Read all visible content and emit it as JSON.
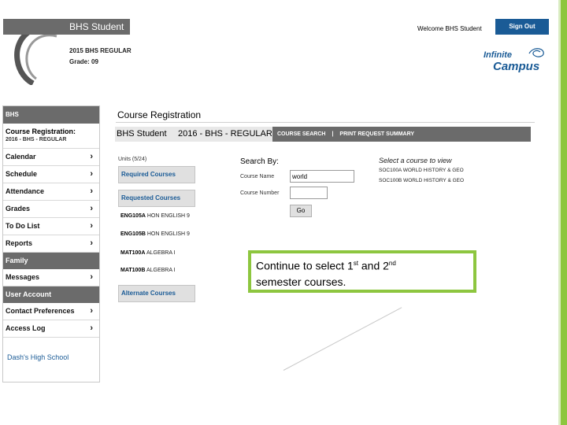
{
  "header": {
    "app_title": "BHS Student",
    "year_line": "2015   BHS   REGULAR",
    "grade_line": "Grade: 09",
    "welcome": "Welcome BHS Student",
    "sign_out": "Sign Out",
    "logo_line1": "Infinite",
    "logo_line2": "Campus"
  },
  "sidebar": {
    "head": "BHS",
    "section_title": "Course Registration:",
    "section_sub": "2016 - BHS - REGULAR",
    "items_top": [
      {
        "label": "Calendar"
      },
      {
        "label": "Schedule"
      },
      {
        "label": "Attendance"
      },
      {
        "label": "Grades"
      },
      {
        "label": "To Do List"
      },
      {
        "label": "Reports"
      }
    ],
    "family_label": "Family",
    "messages_label": "Messages",
    "user_account_label": "User Account",
    "items_bottom": [
      {
        "label": "Contact Preferences"
      },
      {
        "label": "Access Log"
      }
    ],
    "school": "Dash's High School"
  },
  "main": {
    "page_title": "Course Registration",
    "context_student": "BHS Student",
    "context_year": "2016 - BHS - REGULAR",
    "nav_course_search": "COURSE SEARCH",
    "nav_sep": "|",
    "nav_print": "PRINT REQUEST SUMMARY",
    "units": "Units (5/24)",
    "required_courses": "Required Courses",
    "requested_courses": "Requested Courses",
    "courses": [
      {
        "code": "ENG105A",
        "name": "HON ENGLISH 9"
      },
      {
        "code": "ENG105B",
        "name": "HON ENGLISH 9"
      },
      {
        "code": "MAT100A",
        "name": "ALGEBRA I"
      },
      {
        "code": "MAT100B",
        "name": "ALGEBRA I"
      }
    ],
    "alternate_courses": "Alternate Courses",
    "search_by": "Search By:",
    "course_name_label": "Course Name",
    "course_name_value": "world",
    "course_number_label": "Course Number",
    "course_number_value": "",
    "go": "Go",
    "select_label": "Select a course to view",
    "results": [
      {
        "code": "SOC100A",
        "name": "WORLD HISTORY & GEO"
      },
      {
        "code": "SOC100B",
        "name": "WORLD HISTORY & GEO"
      }
    ]
  },
  "callout": {
    "text_a": "Continue to select 1",
    "sup_1": "st",
    "text_b": " and 2",
    "sup_2": "nd",
    "text_c": "semester courses."
  },
  "colors": {
    "accent_green": "#8dc63f",
    "campus_blue": "#1a5b96",
    "bar_gray": "#6b6b6b"
  }
}
